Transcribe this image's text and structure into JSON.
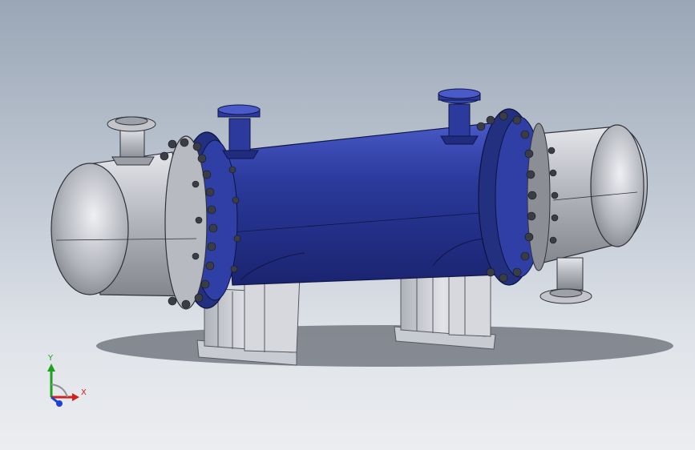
{
  "viewport": {
    "model": "shell-and-tube-heat-exchanger",
    "colors": {
      "shell": "#2b3a9c",
      "shell_dark": "#1a2470",
      "shell_light": "#4a5ac8",
      "heads": "#b6b8c0",
      "supports": "#c9cbd2",
      "bolts": "#3a3d46"
    }
  },
  "triad": {
    "x_label": "X",
    "y_label": "Y",
    "colors": {
      "x": "#d02020",
      "y": "#20a020",
      "z": "#2040d0"
    }
  }
}
